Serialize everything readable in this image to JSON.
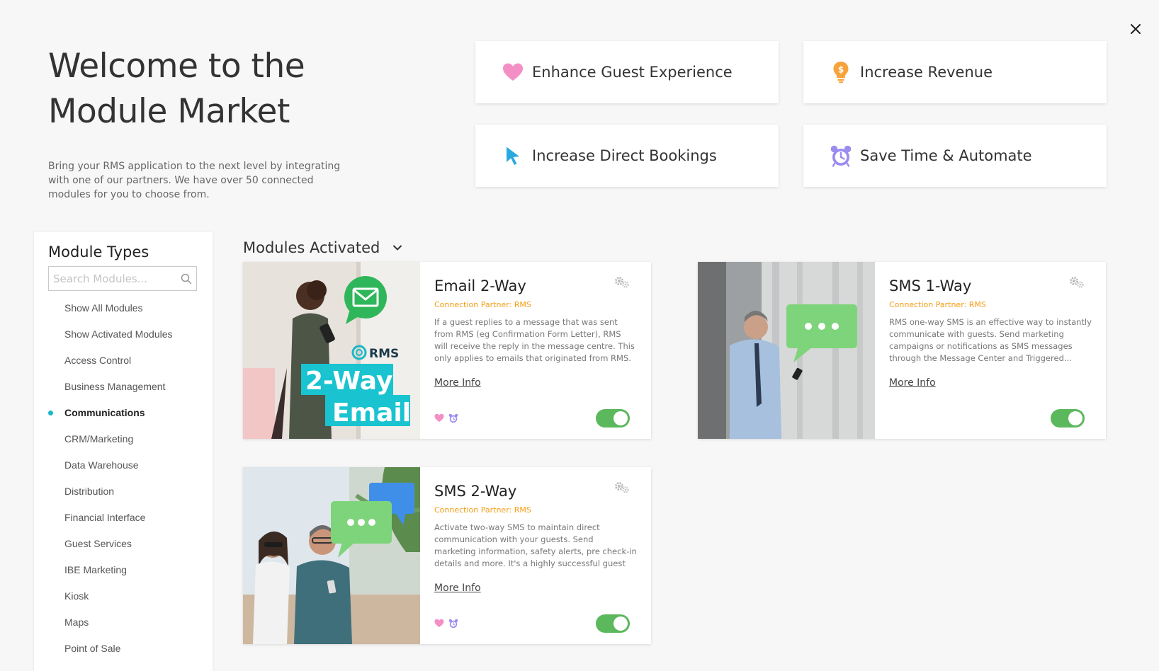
{
  "header": {
    "title_line1": "Welcome to the",
    "title_line2": "Module Market",
    "description": "Bring your RMS application to the next level by integrating with one of our partners. We have over 50 connected modules for you to choose from."
  },
  "goals": [
    {
      "label": "Enhance Guest Experience",
      "icon": "heart-icon",
      "color": "#f48fc6"
    },
    {
      "label": "Increase Revenue",
      "icon": "lightbulb-icon",
      "color": "#f7a23b"
    },
    {
      "label": "Increase Direct Bookings",
      "icon": "cursor-icon",
      "color": "#29a9e0"
    },
    {
      "label": "Save Time & Automate",
      "icon": "alarm-clock-icon",
      "color": "#9b8cf0"
    }
  ],
  "sidebar": {
    "title": "Module Types",
    "search_placeholder": "Search Modules...",
    "items": [
      {
        "label": "Show All Modules",
        "active": false
      },
      {
        "label": "Show Activated Modules",
        "active": false
      },
      {
        "label": "Access Control",
        "active": false
      },
      {
        "label": "Business Management",
        "active": false
      },
      {
        "label": "Communications",
        "active": true
      },
      {
        "label": "CRM/Marketing",
        "active": false
      },
      {
        "label": "Data Warehouse",
        "active": false
      },
      {
        "label": "Distribution",
        "active": false
      },
      {
        "label": "Financial Interface",
        "active": false
      },
      {
        "label": "Guest Services",
        "active": false
      },
      {
        "label": "IBE Marketing",
        "active": false
      },
      {
        "label": "Kiosk",
        "active": false
      },
      {
        "label": "Maps",
        "active": false
      },
      {
        "label": "Point of Sale",
        "active": false
      }
    ]
  },
  "section": {
    "title": "Modules Activated"
  },
  "modules": [
    {
      "title": "Email 2-Way",
      "partner": "Connection Partner: RMS",
      "description": "If a guest replies to a message that was sent from RMS (eg Confirmation Form Letter), RMS will receive the reply in the message centre. This only applies to emails that originated from RMS.",
      "more_info": "More Info",
      "activated": true,
      "tags": [
        "heart-icon",
        "alarm-clock-icon"
      ],
      "image_text": {
        "brand": "RMS",
        "line1": "2-Way",
        "line2": "Email"
      }
    },
    {
      "title": "SMS 1-Way",
      "partner": "Connection Partner: RMS",
      "description": "RMS one-way SMS is an effective way to instantly communicate with guests. Send marketing campaigns or notifications as SMS messages through the Message Center and Triggered...",
      "more_info": "More Info",
      "activated": true,
      "tags": []
    },
    {
      "title": "SMS 2-Way",
      "partner": "Connection Partner: RMS",
      "description": "Activate two-way SMS to maintain direct communication with your guests. Send marketing information, safety alerts, pre check-in details and more. It's a highly successful guest engagement...",
      "more_info": "More Info",
      "activated": true,
      "tags": [
        "heart-icon",
        "alarm-clock-icon"
      ]
    }
  ],
  "colors": {
    "accent": "#19b8c5",
    "partner": "#f39c12",
    "toggle_on": "#5cb85c"
  }
}
